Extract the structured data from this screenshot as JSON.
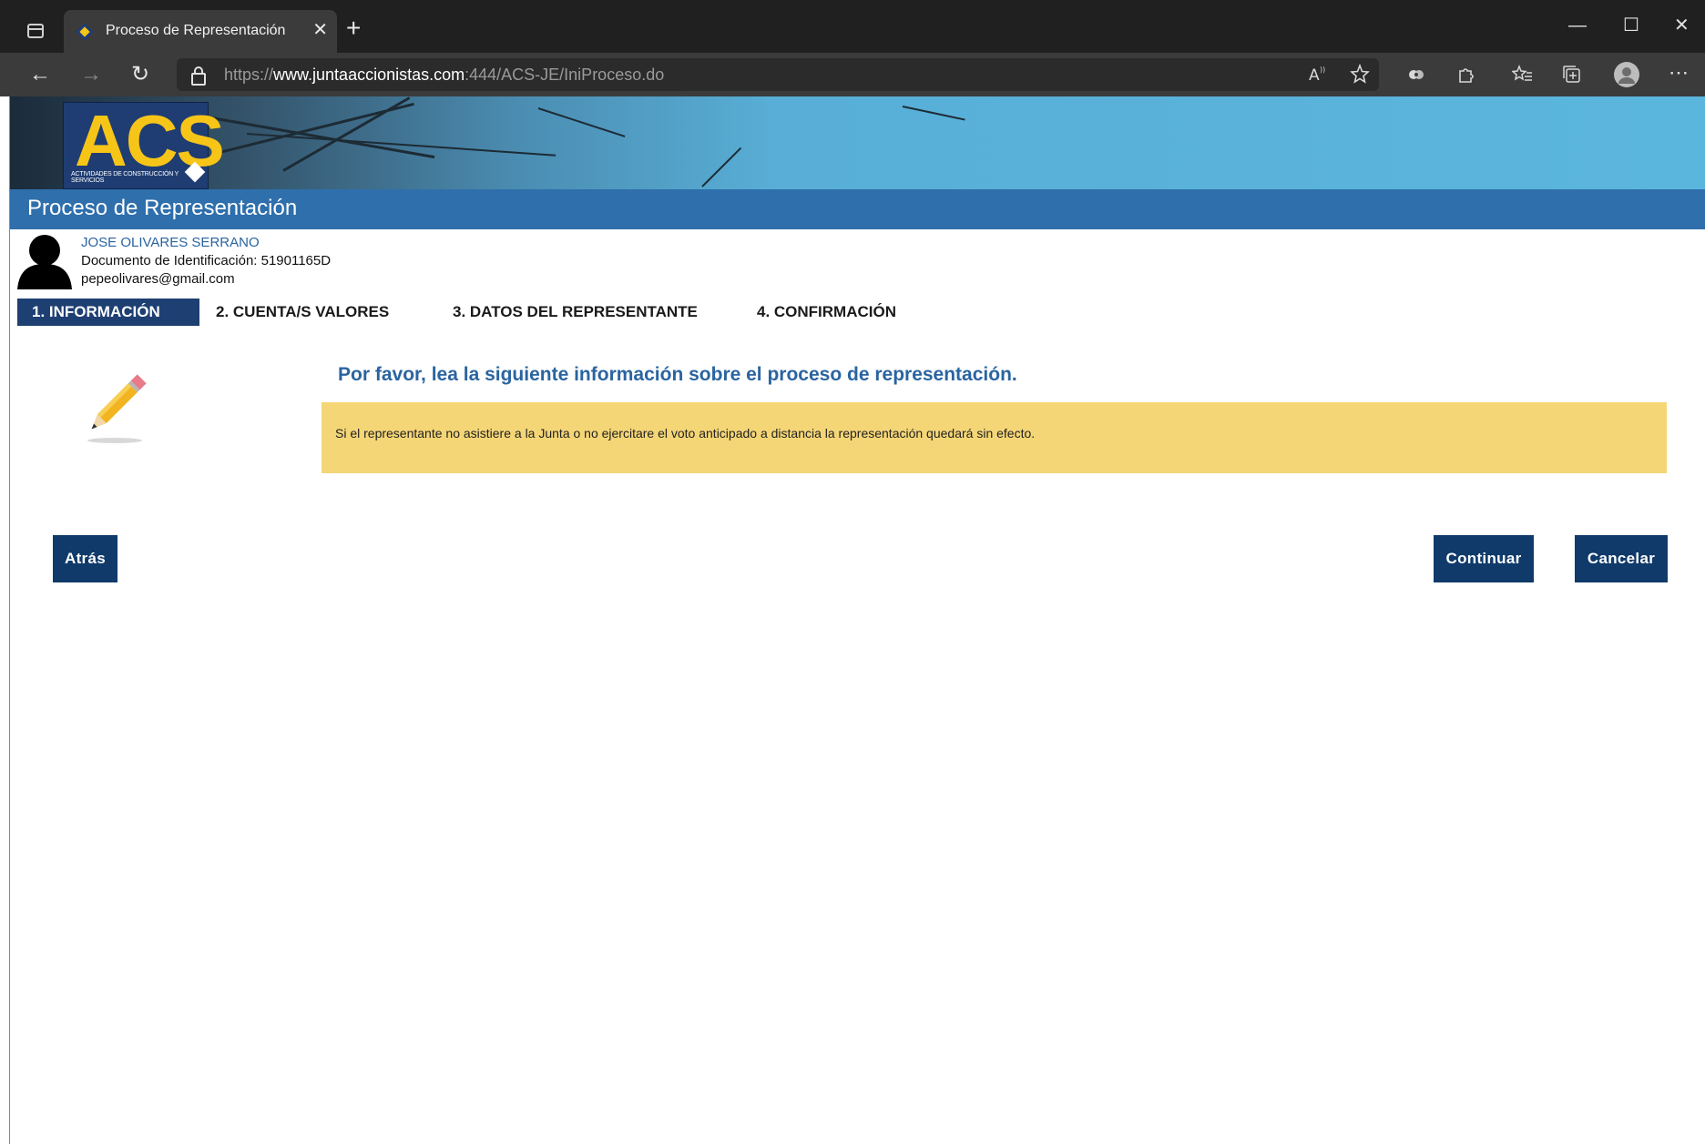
{
  "browser": {
    "tab_title": "Proceso de Representación",
    "tab_close": "✕",
    "new_tab": "+",
    "url_prefix": "https://",
    "url_host": "www.juntaaccionistas.com",
    "url_rest": ":444/ACS-JE/IniProceso.do",
    "window_controls": {
      "minimize": "—",
      "maximize": "☐",
      "close": "✕"
    },
    "nav": {
      "back": "←",
      "forward": "→",
      "refresh": "↻"
    },
    "toolbar_icons": [
      "read-aloud-icon",
      "favorite-add-icon",
      "extension-icon",
      "extensions-icon",
      "favorites-icon",
      "collections-icon",
      "profile-icon",
      "more-icon"
    ]
  },
  "brand": {
    "logo_text": "ACS",
    "logo_subtitle": "ACTIVIDADES DE CONSTRUCCIÓN Y SERVICIOS",
    "logo_color": "#f7c518",
    "header_color": "#2e6fac"
  },
  "page": {
    "title": "Proceso de Representación"
  },
  "user": {
    "name": "JOSE OLIVARES SERRANO",
    "document": "Documento de Identificación: 51901165D",
    "email": "pepeolivares@gmail.com"
  },
  "steps": [
    {
      "label": "1. INFORMACIÓN",
      "active": true
    },
    {
      "label": "2. CUENTA/S VALORES",
      "active": false
    },
    {
      "label": "3. DATOS DEL REPRESENTANTE",
      "active": false
    },
    {
      "label": "4. CONFIRMACIÓN",
      "active": false
    }
  ],
  "content": {
    "heading": "Por favor, lea la siguiente información sobre el proceso de representación.",
    "info_text": "Si el representante no asistiere a la Junta o no ejercitare el voto anticipado a distancia la representación quedará sin efecto.",
    "info_bg": "#f5d676"
  },
  "actions": {
    "back": "Atrás",
    "continue": "Continuar",
    "cancel": "Cancelar",
    "button_color": "#0f3a6a"
  }
}
